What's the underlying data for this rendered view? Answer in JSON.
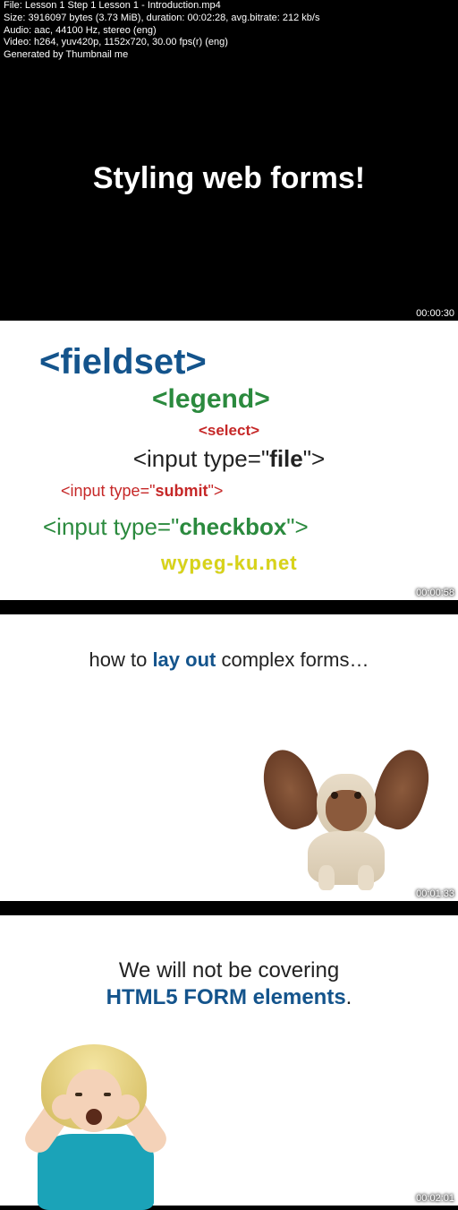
{
  "meta": {
    "file": "File: Lesson 1 Step 1 Lesson 1 - Introduction.mp4",
    "size": "Size: 3916097 bytes (3.73 MiB), duration: 00:02:28, avg.bitrate: 212 kb/s",
    "audio": "Audio: aac, 44100 Hz, stereo (eng)",
    "video": "Video: h264, yuv420p, 1152x720, 30.00 fps(r) (eng)",
    "generated": "Generated by Thumbnail me"
  },
  "frame1": {
    "title": "Styling web forms!",
    "timestamp": "00:00:30"
  },
  "frame2": {
    "fieldset": "<fieldset>",
    "legend": "<legend>",
    "select": "<select>",
    "file_pre": "<input type=\"",
    "file_bold": "file",
    "file_post": "\">",
    "submit_pre": "<input type=\"",
    "submit_bold": "submit",
    "submit_post": "\">",
    "checkbox_pre": "<input type=\"",
    "checkbox_bold": "checkbox",
    "checkbox_post": "\">",
    "watermark": "wypeg-ku.net",
    "timestamp": "00:00:58"
  },
  "frame3": {
    "pre": "how to ",
    "bold": "lay out",
    "post": " complex forms…",
    "timestamp": "00:01:33"
  },
  "frame4": {
    "line1": "We will not be covering",
    "line2_bold": "HTML5 FORM elements",
    "line2_post": ".",
    "timestamp": "00:02:01"
  }
}
